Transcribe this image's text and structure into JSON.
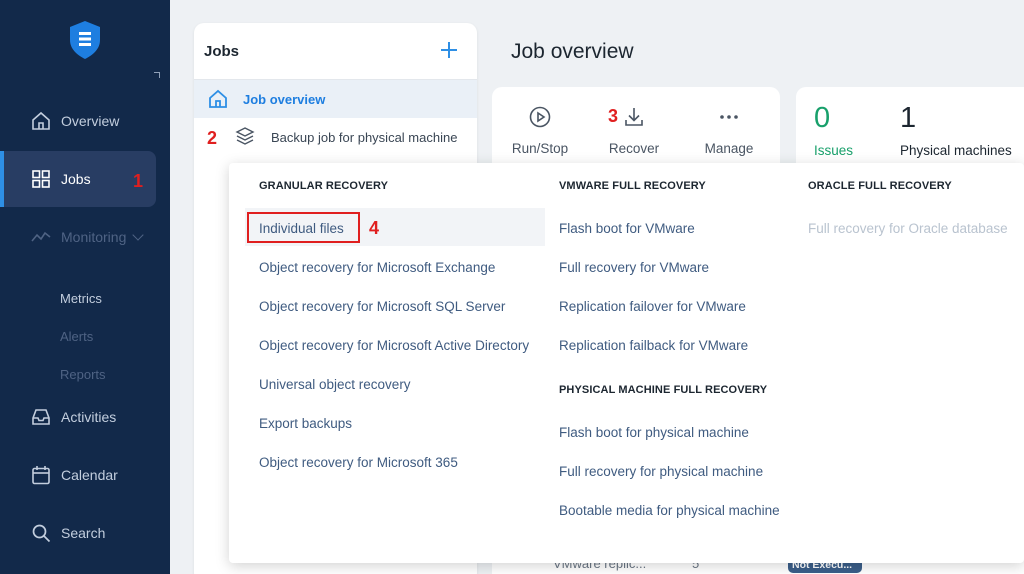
{
  "sidebar": {
    "items": [
      {
        "label": "Overview",
        "icon": "home-icon"
      },
      {
        "label": "Jobs",
        "icon": "grid-icon"
      },
      {
        "label": "Monitoring",
        "icon": "chart-line-icon"
      },
      {
        "label": "Activities",
        "icon": "inbox-icon"
      },
      {
        "label": "Calendar",
        "icon": "calendar-icon"
      },
      {
        "label": "Search",
        "icon": "search-icon"
      }
    ],
    "monitoring_sub": [
      "Metrics",
      "Alerts",
      "Reports"
    ]
  },
  "annotations": [
    "1",
    "2",
    "3",
    "4"
  ],
  "jobs_panel": {
    "title": "Jobs",
    "rows": [
      {
        "label": "Job overview",
        "icon": "home-icon"
      },
      {
        "label": "Backup job for physical machine",
        "icon": "layers-icon"
      }
    ]
  },
  "main": {
    "title": "Job overview",
    "toolbar": [
      {
        "label": "Run/Stop",
        "icon": "play-circle-icon"
      },
      {
        "label": "Recover",
        "icon": "download-icon"
      },
      {
        "label": "Manage",
        "icon": "more-icon"
      }
    ],
    "stats": [
      {
        "value": "0",
        "label": "Issues"
      },
      {
        "value": "1",
        "label": "Physical machines"
      }
    ],
    "bottom_row": {
      "name": "VMware replic...",
      "count": "5",
      "status": "Not Execu..."
    }
  },
  "dropdown": {
    "granular": {
      "heading": "GRANULAR RECOVERY",
      "items": [
        "Individual files",
        "Object recovery for Microsoft Exchange",
        "Object recovery for Microsoft SQL Server",
        "Object recovery for Microsoft Active Directory",
        "Universal object recovery",
        "Export backups",
        "Object recovery for Microsoft 365"
      ]
    },
    "vmware": {
      "heading": "VMWARE FULL RECOVERY",
      "items": [
        "Flash boot for VMware",
        "Full recovery for VMware",
        "Replication failover for VMware",
        "Replication failback for VMware"
      ]
    },
    "physical": {
      "heading": "PHYSICAL MACHINE FULL RECOVERY",
      "items": [
        "Flash boot for physical machine",
        "Full recovery for physical machine",
        "Bootable media for physical machine"
      ]
    },
    "oracle": {
      "heading": "ORACLE FULL RECOVERY",
      "items": [
        "Full recovery for Oracle database"
      ]
    }
  },
  "colors": {
    "sidebar_bg": "#12294a",
    "sidebar_active": "#283d63",
    "accent_blue": "#2e8fe5",
    "issues_green": "#18a06b",
    "annotation_red": "#e01f1f",
    "link_text": "#3f5b80"
  }
}
